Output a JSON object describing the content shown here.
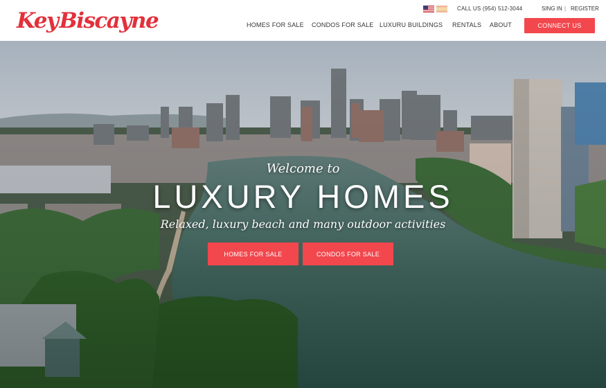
{
  "brand": {
    "name": "KeyBiscayne",
    "part1": "Key",
    "part2": "Biscayne",
    "color": "#e2313b"
  },
  "topbar": {
    "flags": [
      "us-flag-icon",
      "spain-flag-icon"
    ],
    "call": "CALL US (954) 512-3044",
    "signin": "SING IN",
    "separator": "|",
    "register": "REGISTER"
  },
  "nav": {
    "items": [
      {
        "label": "HOMES FOR SALE"
      },
      {
        "label": "CONDOS FOR SALE"
      },
      {
        "label": "LUXURU BUILDINGS"
      },
      {
        "label": "RENTALS"
      },
      {
        "label": "ABOUT"
      }
    ],
    "connect": "CONNECT US",
    "accent": "#f2474d"
  },
  "hero": {
    "welcome": "Welcome to",
    "headline": "LUXURY HOMES",
    "tagline": "Relaxed, luxury beach and many outdoor activities",
    "buttons": [
      "HOMES FOR SALE",
      "CONDOS FOR SALE"
    ]
  }
}
